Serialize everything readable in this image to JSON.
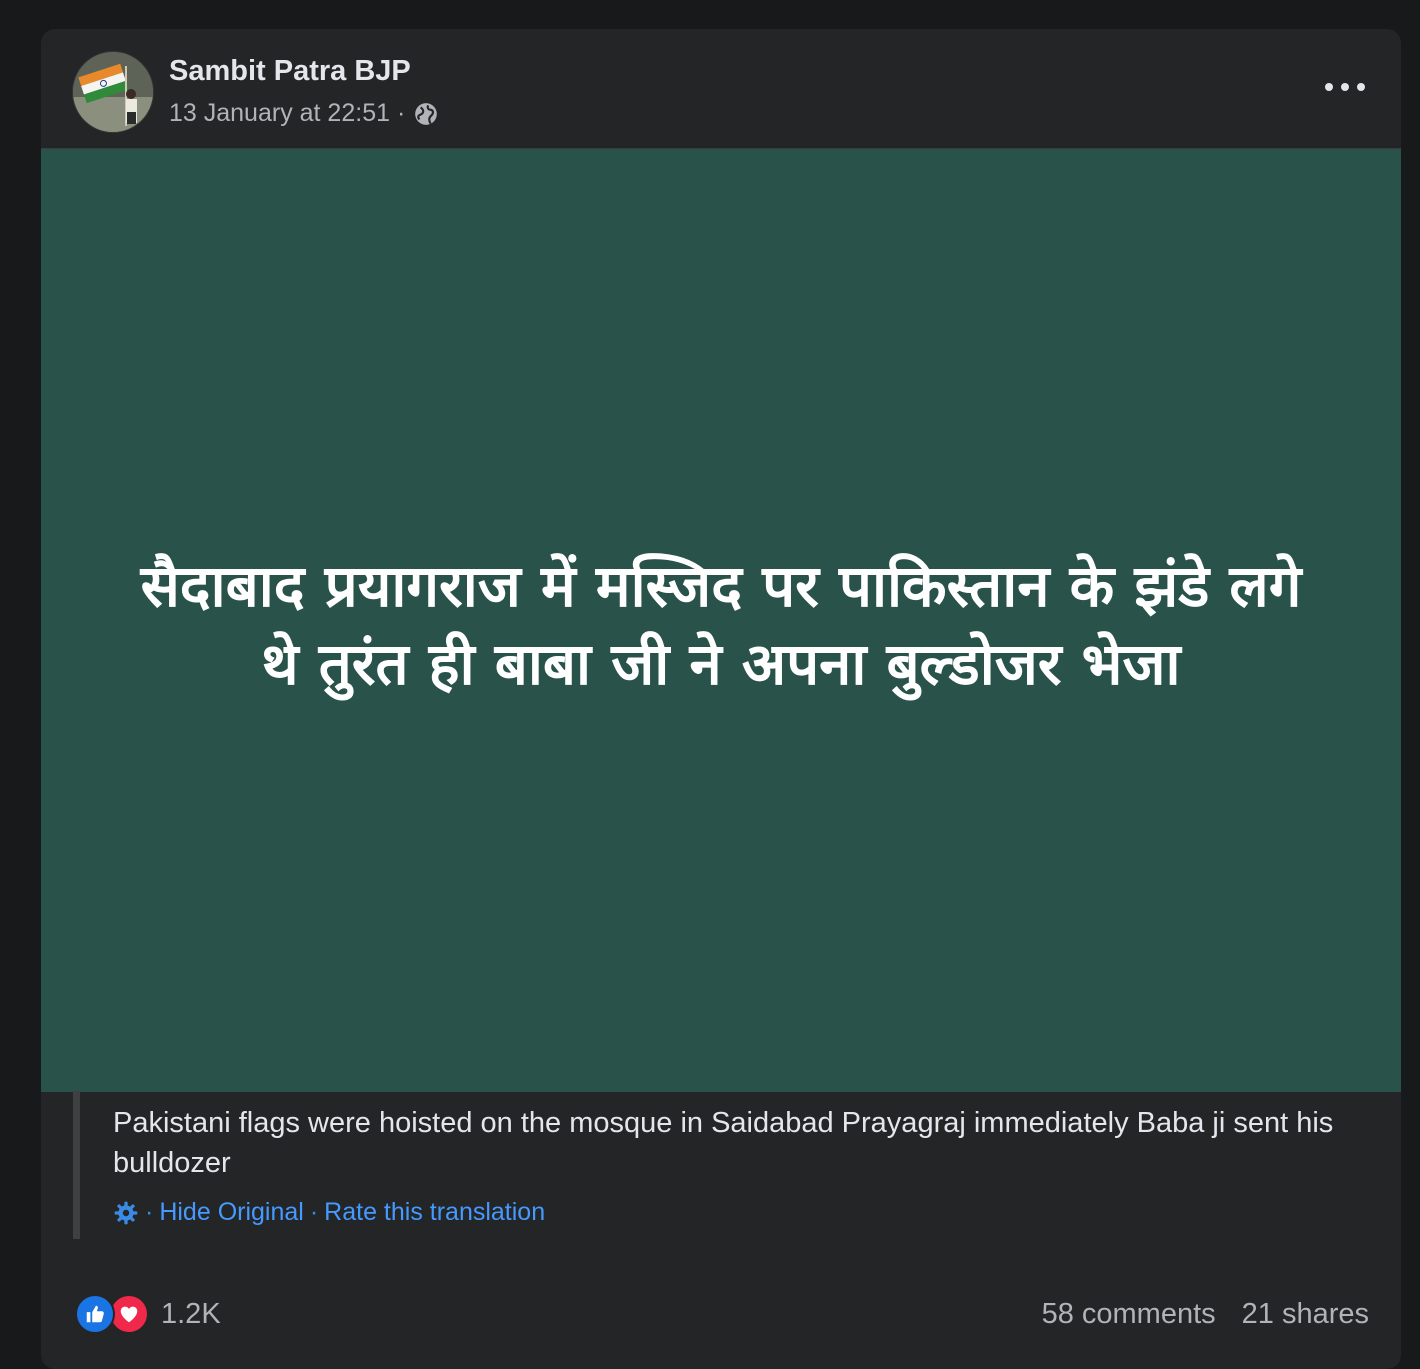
{
  "post": {
    "author": "Sambit Patra BJP",
    "timestamp": "13 January at 22:51 ·",
    "privacy_icon": "globe-icon",
    "more_icon": "more-options-icon"
  },
  "media": {
    "line1": "सैदाबाद प्रयागराज में मस्जिद पर पाकिस्तान के झंडे लगे",
    "line2": "थे तुरंत ही बाबा जी ने अपना बुल्डोजर भेजा",
    "background": "#29534a"
  },
  "translation": {
    "text": "Pakistani flags were hoisted on the mosque in Saidabad Prayagraj immediately Baba ji sent his bulldozer",
    "separator": "·",
    "hide_original": "Hide Original",
    "rate": "Rate this translation",
    "settings_icon": "gear-icon"
  },
  "footer": {
    "reaction_count": "1.2K",
    "comments": "58 comments",
    "shares": "21 shares",
    "reaction_icons": [
      "like-icon",
      "love-icon"
    ]
  },
  "colors": {
    "card": "#242526",
    "page": "#18191a",
    "link": "#4599ff",
    "like": "#1b74e4",
    "love": "#f0284a"
  }
}
